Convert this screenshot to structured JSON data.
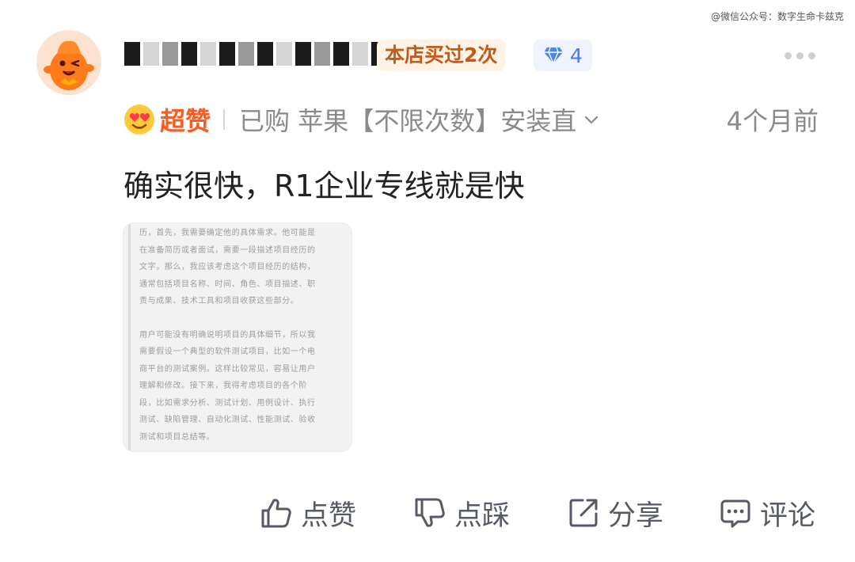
{
  "watermark": "@微信公众号：数字生命卡兹克",
  "user": {
    "name_masked": true,
    "bought_badge": "本店买过2次",
    "level_count": "4",
    "avatar_icon": "orange-mascot-avatar",
    "level_icon": "diamond-icon"
  },
  "meta": {
    "rating_label": "超赞",
    "rating_icon": "heart-eyes-emoji-icon",
    "purchase_info": "已购 苹果【不限次数】安装直",
    "time_ago": "4个月前"
  },
  "review_text": "确实很快，R1企业专线就是快",
  "photo": {
    "lines_p1": [
      "历，首先，我需要确定他的具体需求。他可能是",
      "在准备简历或者面试，需要一段描述项目经历的",
      "文字。那么，我应该考虑这个项目经历的结构，",
      "通常包括项目名称、时间、角色、项目描述、职",
      "责与成果、技术工具和项目收获这些部分。"
    ],
    "lines_p2": [
      "用户可能没有明确说明项目的具体细节，所以我",
      "需要假设一个典型的软件测试项目，比如一个电",
      "商平台的测试案例。这样比较常见，容易让用户",
      "理解和修改。接下来，我得考虑项目的各个阶",
      "段，比如需求分析、测试计划、用例设计、执行",
      "测试、缺陷管理、自动化测试、性能测试、验收",
      "测试和项目总结等。"
    ]
  },
  "actions": {
    "like": "点赞",
    "dislike": "点踩",
    "share": "分享",
    "comment": "评论"
  },
  "colors": {
    "accent_orange": "#ff5a1f",
    "badge_text": "#c35a1a",
    "badge_bg": "#fff3e5",
    "level_blue": "#3f7cf0",
    "muted": "#8a8a8a"
  }
}
